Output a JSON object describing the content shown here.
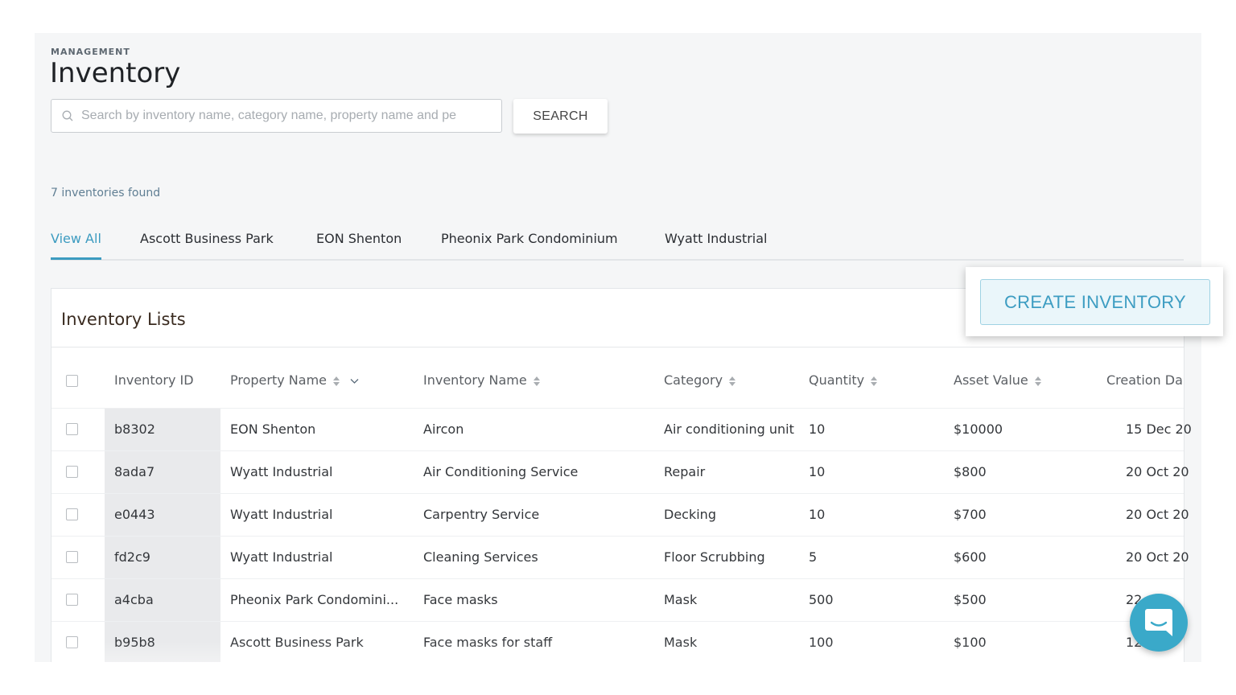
{
  "header": {
    "eyebrow": "MANAGEMENT",
    "title": "Inventory"
  },
  "search": {
    "placeholder": "Search by inventory name, category name, property name and pe",
    "value": "",
    "button_label": "SEARCH"
  },
  "results_text": "7 inventories found",
  "tabs": [
    {
      "label": "View All",
      "active": true
    },
    {
      "label": "Ascott Business Park",
      "active": false
    },
    {
      "label": "EON Shenton",
      "active": false
    },
    {
      "label": "Pheonix Park Condominium",
      "active": false
    },
    {
      "label": "Wyatt Industrial",
      "active": false
    }
  ],
  "create_button_label": "CREATE INVENTORY",
  "card": {
    "title": "Inventory Lists"
  },
  "table": {
    "columns": [
      "Inventory ID",
      "Property Name",
      "Inventory Name",
      "Category",
      "Quantity",
      "Asset Value",
      "Creation Da"
    ],
    "rows": [
      {
        "id": "b8302",
        "property": "EON Shenton",
        "name": "Aircon",
        "category": "Air conditioning unit",
        "quantity": "10",
        "value": "$10000",
        "date": "15 Dec 20"
      },
      {
        "id": "8ada7",
        "property": "Wyatt Industrial",
        "name": "Air Conditioning Service",
        "category": "Repair",
        "quantity": "10",
        "value": "$800",
        "date": "20 Oct 20"
      },
      {
        "id": "e0443",
        "property": "Wyatt Industrial",
        "name": "Carpentry Service",
        "category": "Decking",
        "quantity": "10",
        "value": "$700",
        "date": "20 Oct 20"
      },
      {
        "id": "fd2c9",
        "property": "Wyatt Industrial",
        "name": "Cleaning Services",
        "category": "Floor Scrubbing",
        "quantity": "5",
        "value": "$600",
        "date": "20 Oct 20"
      },
      {
        "id": "a4cba",
        "property": "Pheonix Park Condomini...",
        "name": "Face masks",
        "category": "Mask",
        "quantity": "500",
        "value": "$500",
        "date": "22"
      },
      {
        "id": "b95b8",
        "property": "Ascott Business Park",
        "name": "Face masks for staff",
        "category": "Mask",
        "quantity": "100",
        "value": "$100",
        "date": "12"
      }
    ]
  },
  "colors": {
    "accent": "#3c9bc0",
    "chat": "#3aa9c9"
  },
  "icons": {
    "search": "search-icon",
    "sort": "sort-icon",
    "chevron": "chevron-down-icon",
    "chat": "chat-icon"
  }
}
